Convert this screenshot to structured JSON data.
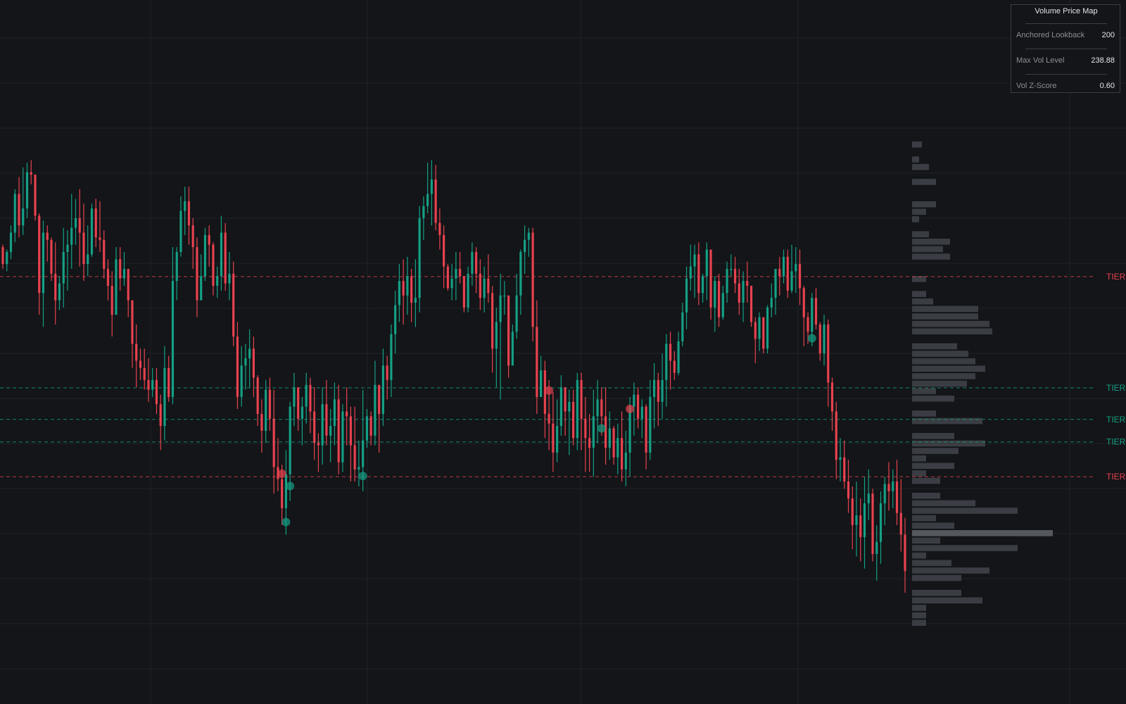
{
  "panel": {
    "title": "Volume Price Map",
    "rows": [
      {
        "label": "Anchored Lookback",
        "value": "200"
      },
      {
        "label": "Max Vol Level",
        "value": "238.88"
      },
      {
        "label": "Vol Z-Score",
        "value": "0.60"
      }
    ]
  },
  "colors": {
    "background": "#131518",
    "grid": "#1f2227",
    "up": "#15a085",
    "down": "#e8424f",
    "profile": "#3a3d43",
    "profile_poc": "#55585e"
  },
  "chart_data": {
    "type": "candlestick",
    "grid": true,
    "title": "",
    "xlabel": "",
    "ylabel": "",
    "tier_label": "TIER",
    "ohlc": [
      [
        192,
        193,
        183,
        185
      ],
      [
        185,
        191,
        182,
        190
      ],
      [
        190,
        201,
        187,
        198
      ],
      [
        198,
        216,
        194,
        214
      ],
      [
        214,
        221,
        196,
        201
      ],
      [
        201,
        225,
        197,
        208
      ],
      [
        208,
        227,
        204,
        223
      ],
      [
        223,
        228,
        218,
        222
      ],
      [
        222,
        222,
        203,
        205
      ],
      [
        205,
        206,
        164,
        173
      ],
      [
        173,
        203,
        159,
        198
      ],
      [
        198,
        201,
        186,
        195
      ],
      [
        195,
        196,
        178,
        181
      ],
      [
        181,
        194,
        160,
        170
      ],
      [
        170,
        180,
        166,
        177
      ],
      [
        177,
        200,
        167,
        190
      ],
      [
        190,
        199,
        174,
        193
      ],
      [
        193,
        214,
        183,
        200
      ],
      [
        200,
        212,
        193,
        204
      ],
      [
        204,
        216,
        184,
        198
      ],
      [
        198,
        210,
        178,
        185
      ],
      [
        185,
        201,
        180,
        189
      ],
      [
        189,
        210,
        188,
        208
      ],
      [
        208,
        212,
        192,
        196
      ],
      [
        196,
        211,
        190,
        195
      ],
      [
        195,
        199,
        179,
        183
      ],
      [
        183,
        187,
        170,
        176
      ],
      [
        176,
        182,
        155,
        164
      ],
      [
        164,
        192,
        166,
        187
      ],
      [
        187,
        192,
        174,
        179
      ],
      [
        179,
        190,
        176,
        183
      ],
      [
        183,
        183,
        163,
        170
      ],
      [
        170,
        170,
        142,
        152
      ],
      [
        152,
        160,
        134,
        145
      ],
      [
        145,
        150,
        137,
        142
      ],
      [
        142,
        150,
        133,
        137
      ],
      [
        137,
        146,
        128,
        133
      ],
      [
        133,
        142,
        130,
        137
      ],
      [
        137,
        142,
        123,
        127
      ],
      [
        127,
        131,
        108,
        118
      ],
      [
        118,
        151,
        112,
        142
      ],
      [
        142,
        147,
        128,
        130
      ],
      [
        130,
        192,
        127,
        178
      ],
      [
        178,
        192,
        170,
        190
      ],
      [
        190,
        213,
        188,
        207
      ],
      [
        207,
        217,
        197,
        211
      ],
      [
        211,
        217,
        193,
        201
      ],
      [
        201,
        204,
        183,
        192
      ],
      [
        192,
        196,
        163,
        170
      ],
      [
        170,
        189,
        172,
        180
      ],
      [
        180,
        200,
        178,
        197
      ],
      [
        197,
        201,
        184,
        193
      ],
      [
        193,
        194,
        172,
        176
      ],
      [
        176,
        184,
        171,
        180
      ],
      [
        180,
        205,
        174,
        198
      ],
      [
        198,
        202,
        174,
        177
      ],
      [
        177,
        190,
        170,
        181
      ],
      [
        181,
        186,
        151,
        155
      ],
      [
        155,
        161,
        125,
        130
      ],
      [
        130,
        151,
        126,
        143
      ],
      [
        143,
        152,
        133,
        146
      ],
      [
        146,
        158,
        134,
        150
      ],
      [
        150,
        155,
        130,
        138
      ],
      [
        138,
        139,
        118,
        123
      ],
      [
        123,
        129,
        107,
        116
      ],
      [
        116,
        137,
        111,
        133
      ],
      [
        133,
        138,
        116,
        121
      ],
      [
        121,
        133,
        90,
        101
      ],
      [
        101,
        113,
        91,
        96
      ],
      [
        96,
        102,
        77,
        84
      ],
      [
        84,
        108,
        73,
        98
      ],
      [
        98,
        128,
        87,
        126
      ],
      [
        126,
        140,
        118,
        134
      ],
      [
        134,
        134,
        116,
        121
      ],
      [
        121,
        130,
        110,
        126
      ],
      [
        126,
        140,
        119,
        135
      ],
      [
        135,
        138,
        115,
        124
      ],
      [
        124,
        134,
        104,
        111
      ],
      [
        111,
        115,
        99,
        110
      ],
      [
        110,
        134,
        102,
        127
      ],
      [
        127,
        137,
        110,
        114
      ],
      [
        114,
        125,
        103,
        118
      ],
      [
        118,
        136,
        110,
        129
      ],
      [
        129,
        135,
        98,
        103
      ],
      [
        103,
        127,
        99,
        124
      ],
      [
        124,
        134,
        110,
        122
      ],
      [
        122,
        126,
        95,
        110
      ],
      [
        110,
        126,
        95,
        100
      ],
      [
        100,
        112,
        93,
        101
      ],
      [
        101,
        133,
        91,
        112
      ],
      [
        112,
        125,
        109,
        122
      ],
      [
        122,
        124,
        110,
        114
      ],
      [
        114,
        145,
        110,
        135
      ],
      [
        135,
        135,
        107,
        123
      ],
      [
        123,
        150,
        118,
        143
      ],
      [
        143,
        147,
        129,
        137
      ],
      [
        137,
        160,
        130,
        156
      ],
      [
        156,
        174,
        148,
        168
      ],
      [
        168,
        185,
        161,
        178
      ],
      [
        178,
        187,
        160,
        172
      ],
      [
        172,
        188,
        164,
        180
      ],
      [
        180,
        183,
        161,
        169
      ],
      [
        169,
        187,
        159,
        171
      ],
      [
        171,
        209,
        165,
        204
      ],
      [
        204,
        213,
        195,
        209
      ],
      [
        209,
        227,
        206,
        214
      ],
      [
        214,
        228,
        201,
        220
      ],
      [
        220,
        226,
        199,
        202
      ],
      [
        202,
        208,
        191,
        197
      ],
      [
        197,
        201,
        175,
        184
      ],
      [
        184,
        185,
        174,
        175
      ],
      [
        175,
        185,
        170,
        179
      ],
      [
        179,
        190,
        170,
        183
      ],
      [
        183,
        190,
        177,
        180
      ],
      [
        180,
        180,
        165,
        167
      ],
      [
        167,
        184,
        165,
        181
      ],
      [
        181,
        194,
        176,
        190
      ],
      [
        190,
        192,
        173,
        181
      ],
      [
        181,
        187,
        166,
        171
      ],
      [
        171,
        184,
        165,
        179
      ],
      [
        179,
        189,
        169,
        173
      ],
      [
        173,
        176,
        140,
        150
      ],
      [
        150,
        167,
        134,
        161
      ],
      [
        161,
        181,
        129,
        172
      ],
      [
        172,
        178,
        164,
        172
      ],
      [
        172,
        172,
        138,
        143
      ],
      [
        143,
        160,
        149,
        157
      ],
      [
        157,
        181,
        154,
        172
      ],
      [
        172,
        191,
        164,
        190
      ],
      [
        190,
        201,
        181,
        195
      ],
      [
        195,
        200,
        188,
        198
      ],
      [
        198,
        200,
        153,
        159
      ],
      [
        159,
        170,
        123,
        130
      ],
      [
        130,
        147,
        130,
        141
      ],
      [
        141,
        145,
        113,
        123
      ],
      [
        123,
        137,
        108,
        119
      ],
      [
        119,
        132,
        99,
        107
      ],
      [
        107,
        129,
        103,
        118
      ],
      [
        118,
        139,
        114,
        134
      ],
      [
        134,
        134,
        114,
        124
      ],
      [
        124,
        133,
        106,
        128
      ],
      [
        128,
        133,
        110,
        113
      ],
      [
        113,
        140,
        108,
        137
      ],
      [
        137,
        140,
        108,
        121
      ],
      [
        121,
        130,
        99,
        113
      ],
      [
        113,
        123,
        99,
        109
      ],
      [
        109,
        133,
        97,
        122
      ],
      [
        122,
        137,
        111,
        129
      ],
      [
        129,
        134,
        114,
        122
      ],
      [
        122,
        134,
        102,
        109
      ],
      [
        109,
        124,
        104,
        117
      ],
      [
        117,
        118,
        102,
        105
      ],
      [
        105,
        119,
        98,
        113
      ],
      [
        113,
        124,
        95,
        100
      ],
      [
        100,
        116,
        93,
        107
      ],
      [
        107,
        130,
        97,
        126
      ],
      [
        126,
        136,
        114,
        131
      ],
      [
        131,
        134,
        117,
        121
      ],
      [
        121,
        129,
        113,
        126
      ],
      [
        126,
        127,
        100,
        107
      ],
      [
        107,
        137,
        104,
        130
      ],
      [
        130,
        144,
        117,
        137
      ],
      [
        137,
        140,
        118,
        128
      ],
      [
        128,
        148,
        121,
        137
      ],
      [
        137,
        156,
        126,
        152
      ],
      [
        152,
        157,
        133,
        145
      ],
      [
        145,
        149,
        137,
        140
      ],
      [
        140,
        157,
        139,
        153
      ],
      [
        153,
        169,
        151,
        165
      ],
      [
        165,
        184,
        158,
        179
      ],
      [
        179,
        193,
        174,
        184
      ],
      [
        184,
        193,
        171,
        189
      ],
      [
        189,
        194,
        168,
        173
      ],
      [
        173,
        181,
        169,
        180
      ],
      [
        180,
        194,
        170,
        191
      ],
      [
        191,
        191,
        162,
        167
      ],
      [
        167,
        180,
        157,
        178
      ],
      [
        178,
        181,
        159,
        163
      ],
      [
        163,
        176,
        162,
        173
      ],
      [
        173,
        186,
        169,
        183
      ],
      [
        183,
        189,
        180,
        183
      ],
      [
        183,
        188,
        173,
        177
      ],
      [
        177,
        183,
        164,
        169
      ],
      [
        169,
        182,
        161,
        178
      ],
      [
        178,
        186,
        169,
        176
      ],
      [
        176,
        176,
        159,
        161
      ],
      [
        161,
        163,
        144,
        154
      ],
      [
        154,
        165,
        149,
        163
      ],
      [
        163,
        163,
        148,
        150
      ],
      [
        150,
        168,
        148,
        167
      ],
      [
        167,
        177,
        163,
        171
      ],
      [
        171,
        183,
        164,
        183
      ],
      [
        183,
        188,
        172,
        180
      ],
      [
        180,
        191,
        177,
        188
      ],
      [
        188,
        191,
        171,
        174
      ],
      [
        174,
        193,
        173,
        182
      ],
      [
        182,
        192,
        173,
        185
      ],
      [
        185,
        191,
        168,
        175
      ],
      [
        175,
        176,
        151,
        163
      ],
      [
        163,
        165,
        152,
        157
      ],
      [
        157,
        173,
        151,
        171
      ],
      [
        171,
        175,
        158,
        160
      ],
      [
        160,
        161,
        145,
        148
      ],
      [
        148,
        164,
        143,
        160
      ],
      [
        160,
        162,
        126,
        136
      ],
      [
        136,
        138,
        116,
        124
      ],
      [
        124,
        128,
        96,
        104
      ],
      [
        104,
        113,
        95,
        105
      ],
      [
        105,
        112,
        92,
        95
      ],
      [
        95,
        104,
        82,
        88
      ],
      [
        88,
        93,
        67,
        77
      ],
      [
        77,
        95,
        64,
        81
      ],
      [
        81,
        88,
        62,
        72
      ],
      [
        72,
        97,
        59,
        86
      ],
      [
        86,
        100,
        79,
        90
      ],
      [
        90,
        92,
        62,
        65
      ],
      [
        65,
        77,
        54,
        70
      ],
      [
        70,
        91,
        61,
        86
      ],
      [
        86,
        97,
        77,
        94
      ],
      [
        94,
        103,
        83,
        91
      ],
      [
        91,
        100,
        84,
        95
      ],
      [
        95,
        104,
        77,
        82
      ],
      [
        82,
        96,
        66,
        73
      ],
      [
        73,
        80,
        49,
        58
      ]
    ],
    "signals": [
      {
        "index": 69,
        "type": "sell"
      },
      {
        "index": 70,
        "type": "buy"
      },
      {
        "index": 71,
        "type": "buy"
      },
      {
        "index": 89,
        "type": "buy"
      },
      {
        "index": 135,
        "type": "sell"
      },
      {
        "index": 148,
        "type": "buy"
      },
      {
        "index": 155,
        "type": "sell"
      },
      {
        "index": 200,
        "type": "buy"
      }
    ],
    "tier_lines": [
      {
        "price": 179.8,
        "type": "sell"
      },
      {
        "price": 133.8,
        "type": "buy"
      },
      {
        "price": 120.7,
        "type": "buy"
      },
      {
        "price": 111.4,
        "type": "buy"
      },
      {
        "price": 97.0,
        "type": "sell"
      }
    ],
    "volume_profile": {
      "price_high": 236,
      "price_low": 35,
      "bins": [
        0.07,
        0.0,
        0.05,
        0.12,
        0.0,
        0.17,
        0.0,
        0.0,
        0.17,
        0.1,
        0.05,
        0.0,
        0.12,
        0.27,
        0.22,
        0.27,
        0.0,
        0.0,
        0.1,
        0.0,
        0.1,
        0.15,
        0.47,
        0.47,
        0.55,
        0.57,
        0.0,
        0.32,
        0.4,
        0.45,
        0.52,
        0.45,
        0.39,
        0.17,
        0.3,
        0.0,
        0.17,
        0.5,
        0.0,
        0.3,
        0.52,
        0.33,
        0.1,
        0.3,
        0.1,
        0.2,
        0.0,
        0.2,
        0.45,
        0.75,
        0.17,
        0.3,
        1.0,
        0.2,
        0.75,
        0.1,
        0.28,
        0.55,
        0.35,
        0.0,
        0.35,
        0.5,
        0.1,
        0.1,
        0.1
      ]
    }
  }
}
